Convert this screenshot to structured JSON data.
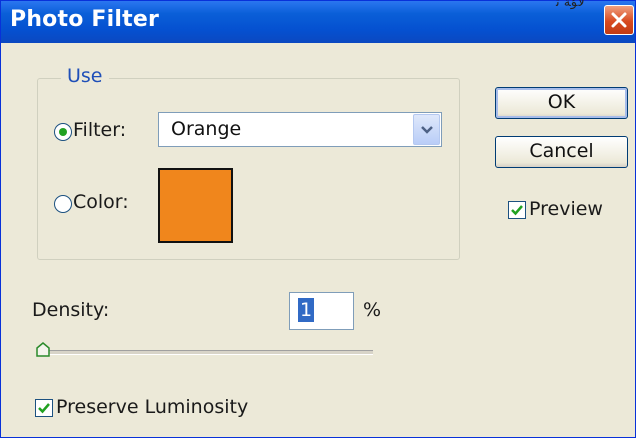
{
  "window": {
    "title": "Photo Filter",
    "clipped_background_text": "ﻷﺆﺔ ﺗ"
  },
  "use_group": {
    "legend": "Use",
    "filter_label": "Filter:",
    "filter_selected": true,
    "filter_value": "Orange",
    "color_label": "Color:",
    "color_selected": false,
    "color_swatch": "#f0861c"
  },
  "buttons": {
    "ok": "OK",
    "cancel": "Cancel"
  },
  "preview": {
    "label": "Preview",
    "checked": true
  },
  "density": {
    "label": "Density:",
    "value": "1",
    "unit": "%",
    "slider_percent": 1
  },
  "preserve_luminosity": {
    "label": "Preserve Luminosity",
    "checked": true
  },
  "colors": {
    "titlebar": "#0a5fd8",
    "dialog_bg": "#ece9d8",
    "accent_green": "#21a121",
    "legend_blue": "#1f4fb8",
    "selection": "#316ac5"
  }
}
